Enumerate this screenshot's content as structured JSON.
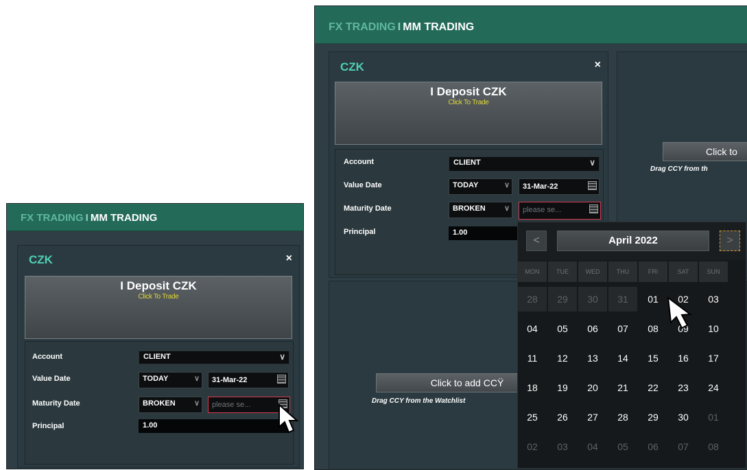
{
  "header": {
    "fx_label": "FX TRADING",
    "separator": "I",
    "mm_label": "MM TRADING"
  },
  "panel": {
    "currency": "CZK",
    "close_symbol": "×",
    "trade_title": "I Deposit CZK",
    "trade_sub": "Click To Trade",
    "account_label": "Account",
    "account_value": "CLIENT",
    "value_date_label": "Value Date",
    "value_date_type": "TODAY",
    "value_date": "31-Mar-22",
    "maturity_label": "Maturity Date",
    "maturity_type": "BROKEN",
    "maturity_placeholder": "please se...",
    "principal_label": "Principal",
    "principal_value": "1.00"
  },
  "right_panels": {
    "add_ccy_partial_top": "Click to",
    "drag_partial_top": "Drag CCY from th",
    "add_ccy_partial_bottom": "Click to add CCŸ",
    "drag_partial_bottom": "Drag CCY from the Watchlist"
  },
  "calendar": {
    "prev_symbol": "<",
    "next_symbol": ">",
    "month_label": "April 2022",
    "weekdays": [
      "MON",
      "TUE",
      "WED",
      "THU",
      "FRI",
      "SAT",
      "SUN"
    ],
    "weeks": [
      [
        "28",
        "29",
        "30",
        "31",
        "01",
        "02",
        "03"
      ],
      [
        "04",
        "05",
        "06",
        "07",
        "08",
        "09",
        "10"
      ],
      [
        "11",
        "12",
        "13",
        "14",
        "15",
        "16",
        "17"
      ],
      [
        "18",
        "19",
        "20",
        "21",
        "22",
        "23",
        "24"
      ],
      [
        "25",
        "26",
        "27",
        "28",
        "29",
        "30",
        "01"
      ],
      [
        "02",
        "03",
        "04",
        "05",
        "06",
        "07",
        "08"
      ]
    ]
  },
  "icons": {
    "calendar": "calendar-icon",
    "chevron": "chevron-down-icon",
    "cursor": "mouse-pointer-icon"
  }
}
